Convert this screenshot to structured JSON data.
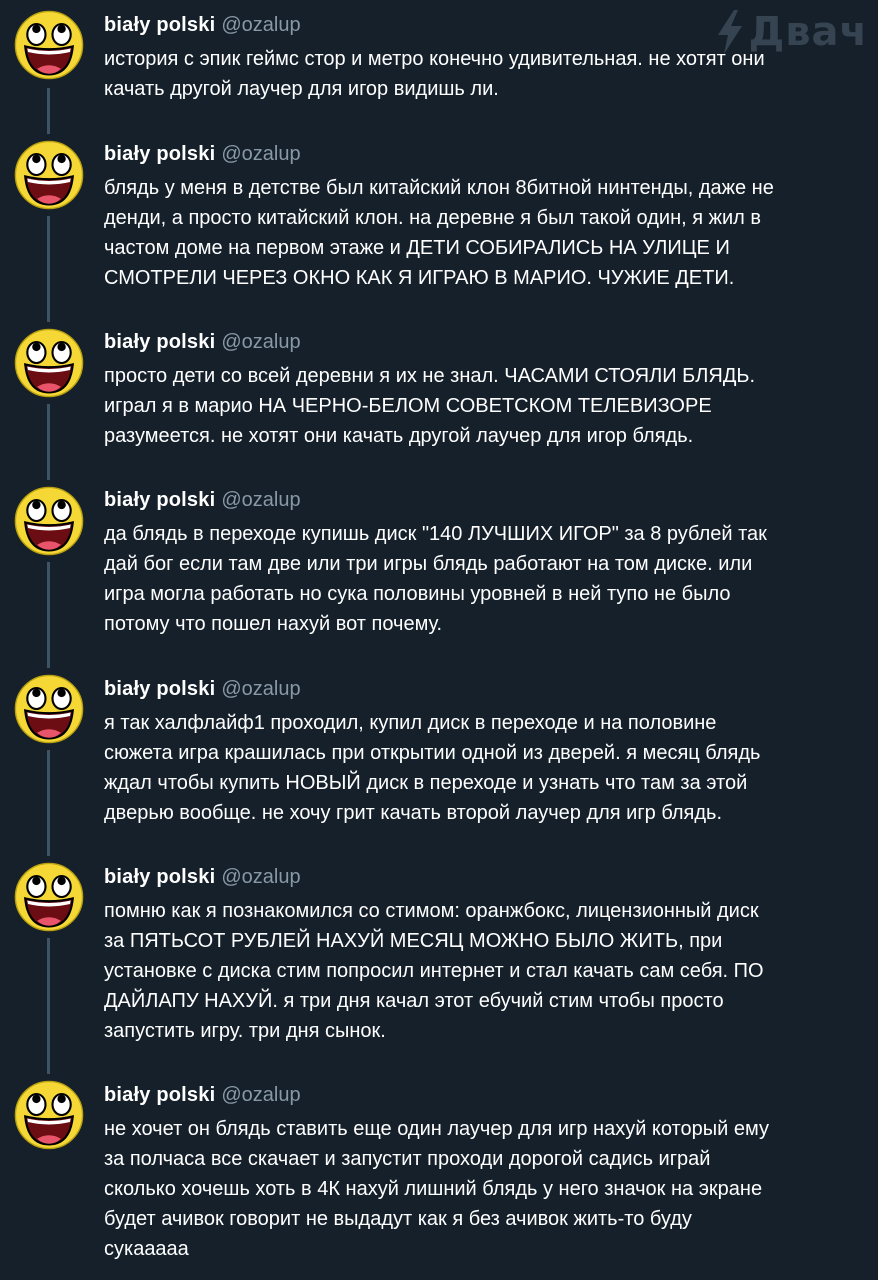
{
  "watermark": {
    "text": "Двач",
    "icon": "lightning-bolt-icon"
  },
  "author": {
    "name": "biały polski",
    "handle": "@ozalup",
    "avatar": "awesome-face-avatar"
  },
  "colors": {
    "background": "#15202b",
    "text": "#ffffff",
    "secondary": "#8899a6",
    "thread_line": "#3d5466"
  },
  "tweets": [
    {
      "text": "история с эпик геймс стор и метро конечно удивительная. не хотят они\nкачать другой лаучер для игор видишь ли."
    },
    {
      "text": "блядь у меня в детстве был китайский клон 8битной нинтенды, даже не\nденди, а просто китайский клон. на деревне я был такой один, я жил в\nчастом доме на первом этаже и ДЕТИ СОБИРАЛИСЬ НА УЛИЦЕ И\nСМОТРЕЛИ ЧЕРЕЗ ОКНО КАК Я ИГРАЮ В МАРИО. ЧУЖИЕ ДЕТИ."
    },
    {
      "text": "просто дети со всей деревни я их не знал. ЧАСАМИ СТОЯЛИ БЛЯДЬ.\nиграл я в марио НА ЧЕРНО-БЕЛОМ СОВЕТСКОМ ТЕЛЕВИЗОРЕ\nразумеется. не хотят они качать другой лаучер для игор блядь."
    },
    {
      "text": "да блядь в переходе купишь диск \"140 ЛУЧШИХ ИГОР\" за 8 рублей так\nдай бог если там две или три игры блядь работают на том диске. или\nигра могла работать но сука половины уровней в ней тупо не было\nпотому что пошел нахуй вот почему."
    },
    {
      "text": "я так халфлайф1 проходил, купил диск в переходе и на половине\nсюжета игра крашилась при открытии одной из дверей. я месяц блядь\nждал чтобы купить НОВЫЙ диск в переходе и узнать что там за этой\nдверью вообще. не хочу грит качать второй лаучер для игр блядь."
    },
    {
      "text": "помню как я познакомился со стимом: оранжбокс, лицензионный диск\nза ПЯТЬСОТ РУБЛЕЙ НАХУЙ МЕСЯЦ МОЖНО БЫЛО ЖИТЬ, при\nустановке с диска стим попросил интернет и стал качать сам себя. ПО\nДАЙЛАПУ НАХУЙ. я три дня качал этот ебучий стим чтобы просто\nзапустить игру. три дня сынок."
    },
    {
      "text": "не хочет он блядь ставить еще один лаучер для игр нахуй который ему\nза полчаса все скачает и запустит проходи дорогой садись играй\nсколько хочешь хоть в 4К нахуй лишний блядь у него значок на экране\nбудет ачивок говорит не выдадут как я без ачивок жить-то буду\nсукааааа"
    }
  ]
}
